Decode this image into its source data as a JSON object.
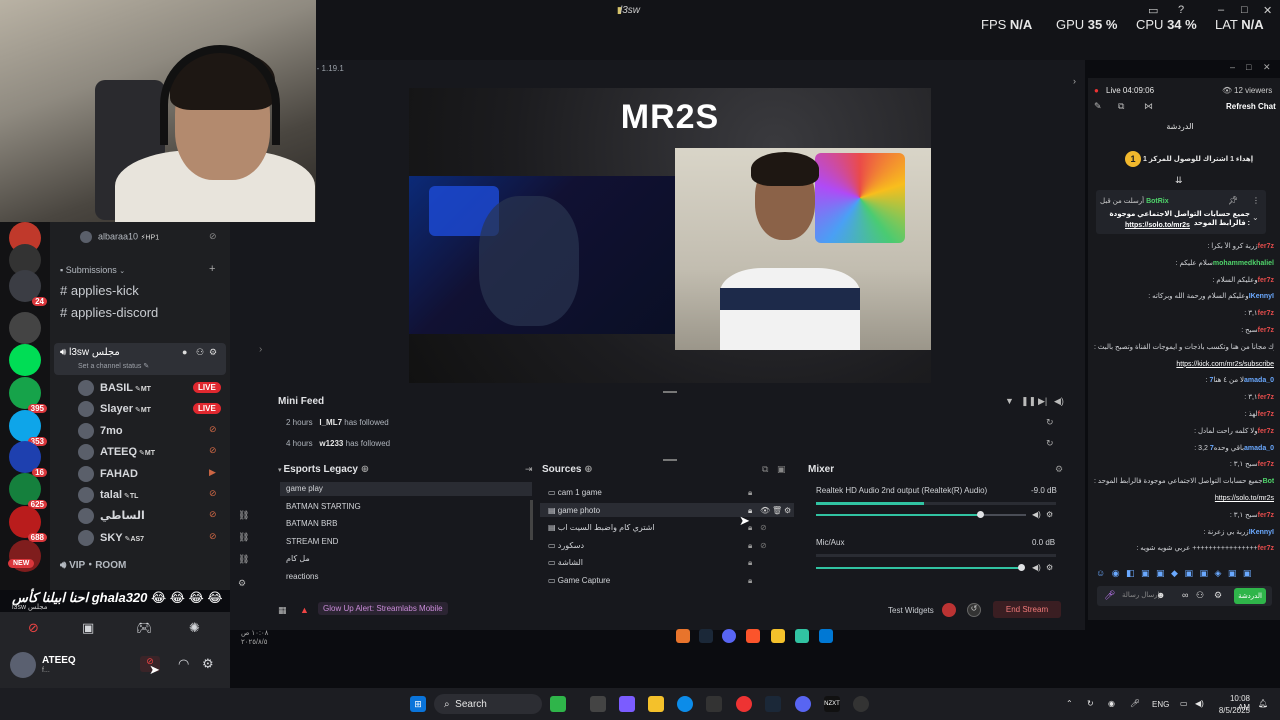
{
  "top_bar": {
    "window_title": "l3sw",
    "fps_label": "FPS",
    "fps_value": "N/A",
    "gpu_label": "GPU",
    "gpu_value": "35",
    "cpu_label": "CPU",
    "cpu_value": "34",
    "lat_label": "LAT",
    "lat_value": "N/A",
    "percent": "%"
  },
  "discord": {
    "servers": [
      {
        "badge": ""
      },
      {
        "badge": "24"
      },
      {
        "badge": ""
      },
      {
        "badge": ""
      },
      {
        "badge": "395"
      },
      {
        "badge": "353"
      },
      {
        "badge": "16"
      },
      {
        "badge": "625"
      },
      {
        "badge": "688"
      }
    ],
    "new_badge": "NEW",
    "top_member": {
      "name": "albaraa10",
      "tag": "HP1"
    },
    "category": "Submissions",
    "channels": [
      "applies-kick",
      "applies-discord"
    ],
    "voice_channel": {
      "name": "l3sw مجلس",
      "status": "Set a channel status"
    },
    "members": [
      {
        "name": "BASIL",
        "tag": "MT",
        "live": "LIVE"
      },
      {
        "name": "Slayer",
        "tag": "MT",
        "live": "LIVE"
      },
      {
        "name": "7mo",
        "tag": "",
        "live": ""
      },
      {
        "name": "ATEEQ",
        "tag": "MT",
        "live": ""
      },
      {
        "name": "FAHAD",
        "tag": "",
        "live": ""
      },
      {
        "name": "talal",
        "tag": "TL",
        "live": ""
      },
      {
        "name": "الساطي",
        "tag": "",
        "live": ""
      },
      {
        "name": "SKY",
        "tag": "AS7",
        "live": ""
      }
    ],
    "vip_room": "VIP・ROOM",
    "overlay_message": "احنا ابيلنا كأس ghala320",
    "overlay_sub": "l3sw مجلس",
    "user": {
      "name": "ATEEQ",
      "status": "f..."
    }
  },
  "streamlabs": {
    "version": "p - 1.19.1",
    "preview_title": "MR2S",
    "mini_feed": {
      "title": "Mini Feed",
      "rows": [
        {
          "time": "2 hours",
          "user": "l_ML7",
          "action": "has followed"
        },
        {
          "time": "4 hours",
          "user": "w1233",
          "action": "has followed"
        }
      ]
    },
    "scenes": {
      "title": "Esports Legacy",
      "items": [
        "game play",
        "BATMAN STARTING",
        "BATMAN BRB",
        "STREAM END",
        "مل كام",
        "reactions"
      ]
    },
    "sources": {
      "title": "Sources",
      "items": [
        "cam 1 game",
        "game photo",
        "اشتري كام واضبط السيت اب",
        "دسكورد",
        "الشاشة",
        "Game Capture"
      ]
    },
    "mixer": {
      "title": "Mixer",
      "items": [
        {
          "name": "Realtek HD Audio 2nd output (Realtek(R) Audio)",
          "db": "-9.0 dB",
          "level": 0.45,
          "volume": 0.78
        },
        {
          "name": "Mic/Aux",
          "db": "0.0 dB",
          "level": 0.0,
          "volume": 1.0
        }
      ]
    },
    "alert": "Glow Up Alert: Streamlabs Mobile",
    "test_widgets": "Test Widgets",
    "end_stream": "End Stream",
    "clock_small": "١٠:٠٨ ص",
    "date_small": "٢٠٢٥/٨/٥"
  },
  "chat": {
    "live_time": "Live 04:09:06",
    "viewers": "12 viewers",
    "refresh": "Refresh Chat",
    "title": "الدردشة",
    "goal": "إهداء 1 اشتراك للوصول للمركز 1",
    "pinned": {
      "user": "BotRix",
      "prefix": "أرسلت من قبل",
      "text": "جميع حسابات التواصل الاجتماعي موجودة فالرابط الموحد :",
      "link": "https://solo.to/mr2s"
    },
    "lines": [
      {
        "user": "fer7z",
        "text": ": زربة كرو الأ بكرا",
        "cls": "u-red"
      },
      {
        "user": "mohammedkhaliel",
        "text": ": سلام عليكم",
        "cls": "u-green"
      },
      {
        "user": "fer7z",
        "text": ": وعليكم السلام",
        "cls": "u-red"
      },
      {
        "user": "IKennyI",
        "text": ": وعليكم السلام ورحمة الله وبركاته",
        "cls": "u-blue"
      },
      {
        "user": "fer7z",
        "text": ": ٣,١",
        "cls": "u-red"
      },
      {
        "user": "fer7z",
        "text": ": سبح",
        "cls": "u-red"
      },
      {
        "user": "BotRix",
        "text": ": تقدر تشترك مجاناً من هنا وتكسب باذجات و ايموجات القناة وتصبح بالبث",
        "cls": "u-green"
      },
      {
        "user": "",
        "text": "https://kick.com/mr2s/subscribe",
        "cls": "link"
      },
      {
        "user": "7amada_0",
        "text": ": لا من ٤ هنا",
        "cls": "u-blue"
      },
      {
        "user": "fer7z",
        "text": ": ٣,١",
        "cls": "u-red"
      },
      {
        "user": "fer7z",
        "text": ": لهذ",
        "cls": "u-red"
      },
      {
        "user": "fer7z",
        "text": ": ولا كلمه راحت لمادل",
        "cls": "u-red"
      },
      {
        "user": "7amada_0",
        "text": ": 3,2 باقي وحده",
        "cls": "u-blue"
      },
      {
        "user": "fer7z",
        "text": ": سبح ٣,١",
        "cls": "u-red"
      },
      {
        "user": "BotRix",
        "text": ": جميع حسابات التواصل الاجتماعي موجودة فالرابط الموحد",
        "cls": "u-green"
      },
      {
        "user": "",
        "text": "https://solo.to/mr2s",
        "cls": "link"
      },
      {
        "user": "fer7z",
        "text": ": سبح ٣,١",
        "cls": "u-red"
      },
      {
        "user": "IKennyI",
        "text": ": زربة بي زعرنة",
        "cls": "u-blue"
      },
      {
        "user": "fer7z",
        "text": ": عربي شويه شويه ++++++++++++++++",
        "cls": "u-red"
      }
    ],
    "input_placeholder": "إرسال رسالة",
    "send": "الدردشة"
  },
  "taskbar": {
    "search": "Search",
    "lang": "ENG",
    "time": "10:08 AM",
    "date": "8/5/2025"
  }
}
